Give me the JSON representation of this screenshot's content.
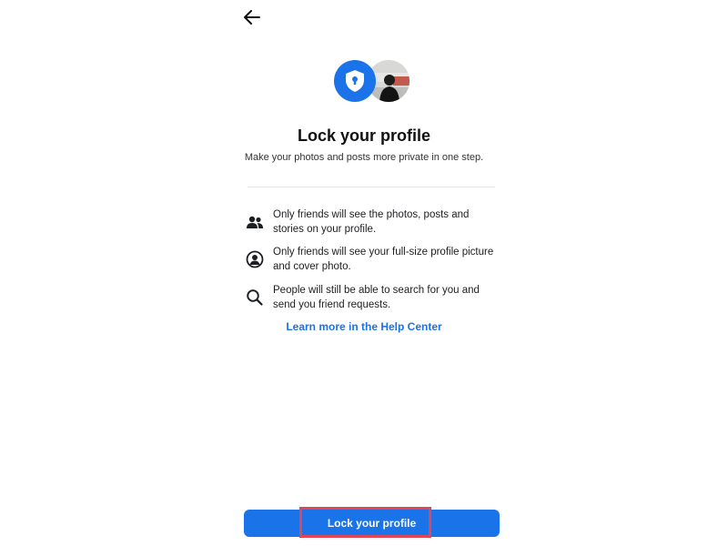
{
  "header": {
    "back_icon": "arrow-left-icon"
  },
  "hero": {
    "shield_icon": "shield-lock-icon",
    "accent_color": "#1a73e8"
  },
  "title": "Lock your profile",
  "subtitle": "Make your photos and posts more private in one step.",
  "features": [
    {
      "icon": "friends-icon",
      "text": "Only friends will see the photos, posts and stories on your profile."
    },
    {
      "icon": "profile-circle-icon",
      "text": "Only friends will see your full-size profile picture and cover photo."
    },
    {
      "icon": "search-icon",
      "text": "People will still be able to search for you and send you friend requests."
    }
  ],
  "help_link": "Learn more in the Help Center",
  "primary_button": {
    "label": "Lock your profile",
    "color": "#1a73e8",
    "highlight_color": "#e04654"
  }
}
